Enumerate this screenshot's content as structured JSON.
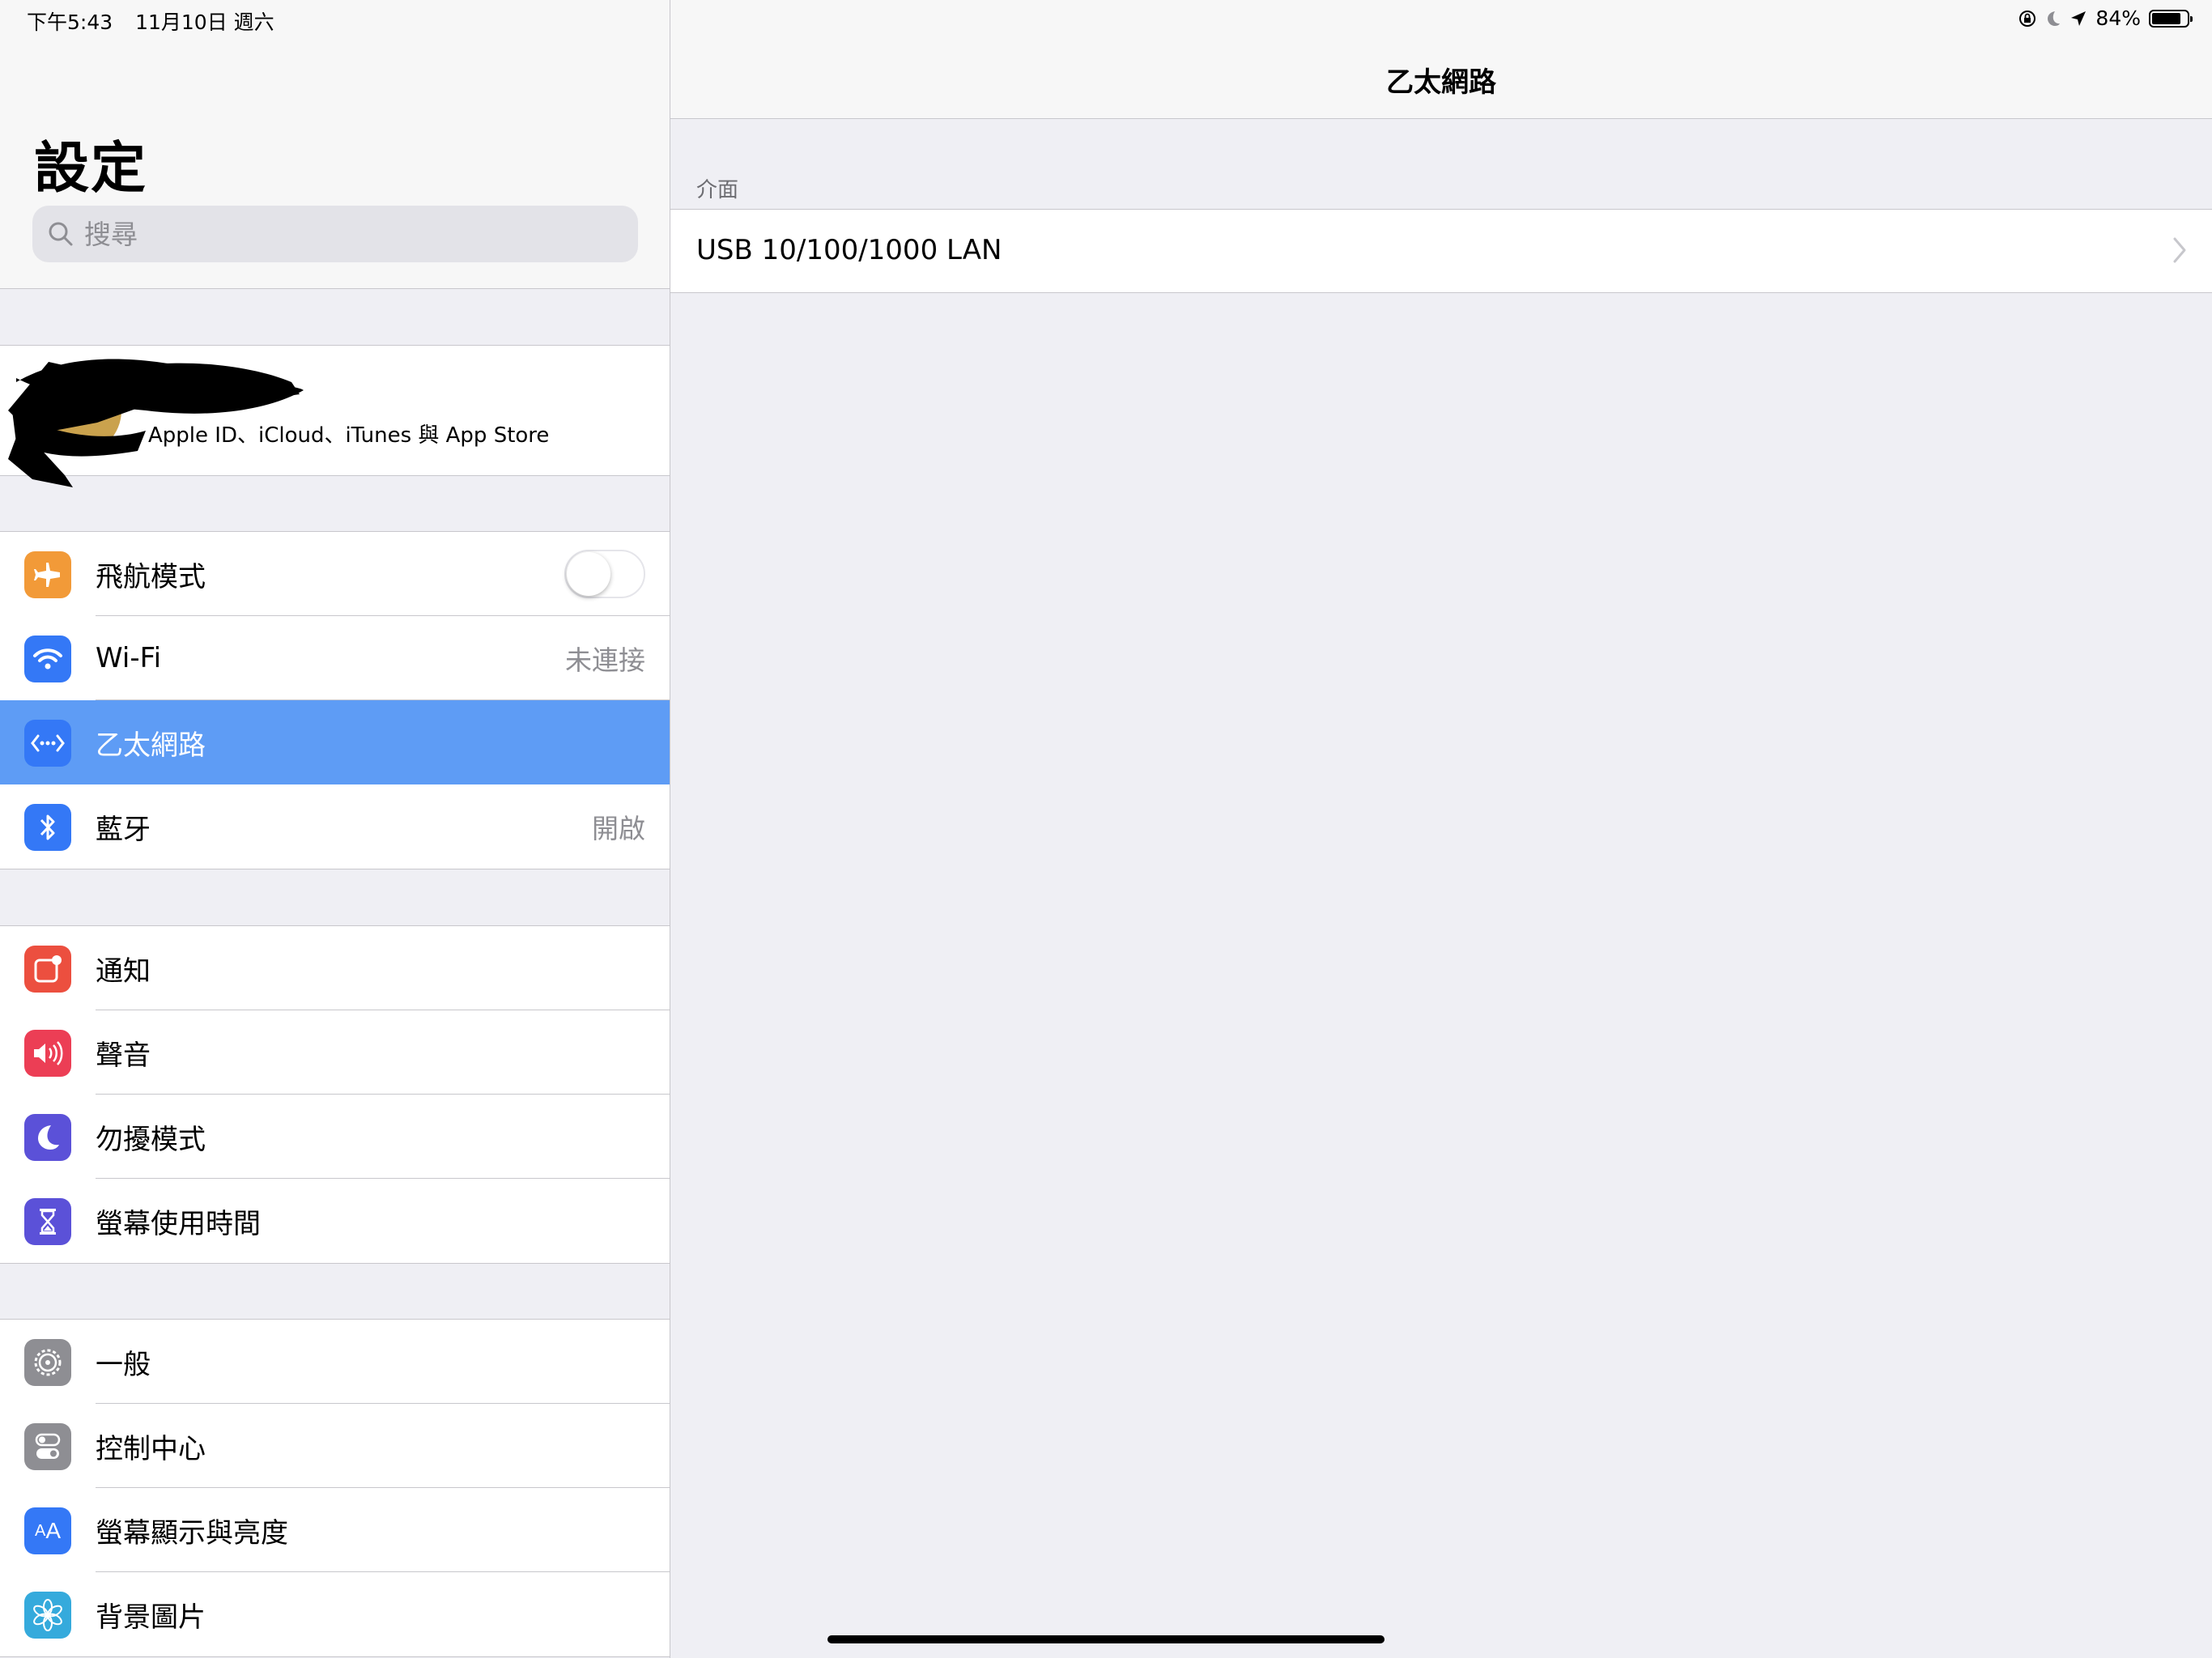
{
  "status_bar": {
    "time": "下午5:43",
    "date": "11月10日 週六",
    "battery_text": "84%",
    "battery_level": 0.84
  },
  "sidebar": {
    "title": "設定",
    "search": {
      "placeholder": "搜尋"
    },
    "profile": {
      "subtitle": "Apple ID、iCloud、iTunes 與 App Store"
    },
    "groups": [
      {
        "items": [
          {
            "label": "飛航模式",
            "icon": "airplane-icon",
            "color": "#f29a38",
            "toggle": false
          },
          {
            "label": "Wi-Fi",
            "icon": "wifi-icon",
            "color": "#3478f6",
            "value": "未連接"
          },
          {
            "label": "乙太網路",
            "icon": "ethernet-icon",
            "color": "#3478f6",
            "selected": true
          },
          {
            "label": "藍牙",
            "icon": "bluetooth-icon",
            "color": "#3478f6",
            "value": "開啟"
          }
        ]
      },
      {
        "items": [
          {
            "label": "通知",
            "icon": "notifications-icon",
            "color": "#ec4f3f"
          },
          {
            "label": "聲音",
            "icon": "sound-icon",
            "color": "#ec3e55"
          },
          {
            "label": "勿擾模式",
            "icon": "moon-icon",
            "color": "#5b51d8"
          },
          {
            "label": "螢幕使用時間",
            "icon": "hourglass-icon",
            "color": "#5b51d8"
          }
        ]
      },
      {
        "items": [
          {
            "label": "一般",
            "icon": "gear-icon",
            "color": "#8e8e93"
          },
          {
            "label": "控制中心",
            "icon": "switches-icon",
            "color": "#8e8e93"
          },
          {
            "label": "螢幕顯示與亮度",
            "icon": "text-size-icon",
            "color": "#3478f6"
          },
          {
            "label": "背景圖片",
            "icon": "flower-icon",
            "color": "#35aadc"
          }
        ]
      }
    ]
  },
  "detail": {
    "title": "乙太網路",
    "section_header": "介面",
    "rows": [
      {
        "label": "USB 10/100/1000 LAN"
      }
    ]
  }
}
